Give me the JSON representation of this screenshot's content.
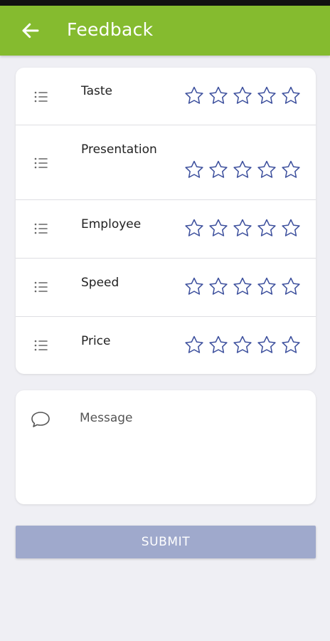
{
  "header": {
    "title": "Feedback",
    "back_icon": "arrow-left-icon",
    "background": "#85bb2f"
  },
  "ratings": {
    "list_icon": "list-bullet-icon",
    "star_icon": "star-outline-icon",
    "star_color": "#3b4e9c",
    "items": [
      {
        "label": "Taste",
        "stars": 0,
        "max": 5
      },
      {
        "label": "Presentation",
        "stars": 0,
        "max": 5
      },
      {
        "label": "Employee",
        "stars": 0,
        "max": 5
      },
      {
        "label": "Speed",
        "stars": 0,
        "max": 5
      },
      {
        "label": "Price",
        "stars": 0,
        "max": 5
      }
    ]
  },
  "message": {
    "icon": "chat-bubble-icon",
    "placeholder": "Message",
    "value": ""
  },
  "submit": {
    "label": "SUBMIT",
    "color": "#9fa9cc"
  }
}
